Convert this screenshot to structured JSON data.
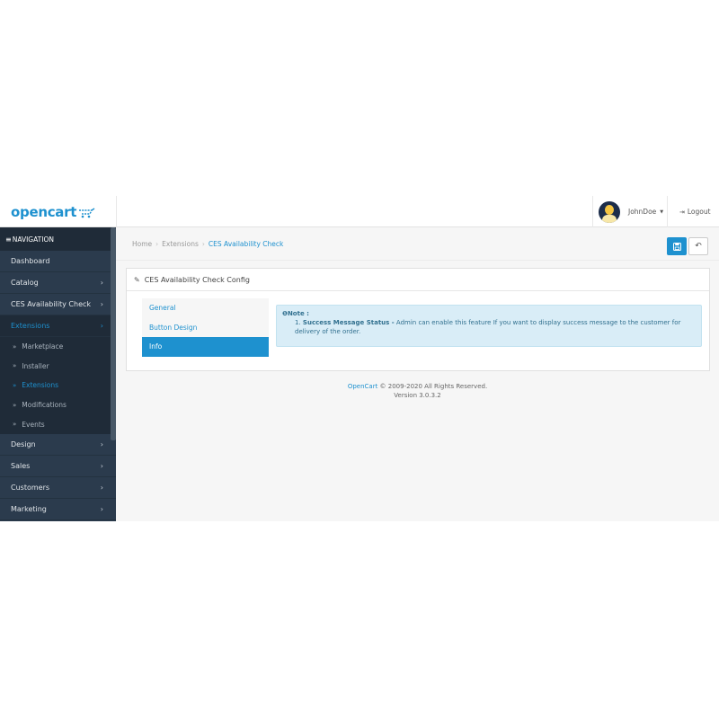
{
  "header": {
    "logo_text": "opencart",
    "username": "JohnDoe",
    "logout_label": "Logout"
  },
  "sidebar": {
    "nav_title": "NAVIGATION",
    "items": [
      {
        "label": "Dashboard",
        "chevron": false
      },
      {
        "label": "Catalog",
        "chevron": true
      },
      {
        "label": "CES Availability Check",
        "chevron": true
      },
      {
        "label": "Extensions",
        "chevron": true,
        "active": true
      }
    ],
    "sub_items": [
      {
        "label": "Marketplace"
      },
      {
        "label": "Installer"
      },
      {
        "label": "Extensions",
        "active": true
      },
      {
        "label": "Modifications"
      },
      {
        "label": "Events"
      }
    ],
    "items_after": [
      {
        "label": "Design"
      },
      {
        "label": "Sales"
      },
      {
        "label": "Customers"
      },
      {
        "label": "Marketing"
      }
    ]
  },
  "breadcrumb": [
    "Home",
    "Extensions",
    "CES Availability Check"
  ],
  "panel": {
    "title": "CES Availability Check Config",
    "tabs": [
      "General",
      "Button Design",
      "Info"
    ],
    "active_tab": "Info",
    "note": {
      "title": "Note :",
      "item_number": "1.",
      "item_bold": "Success Message Status -",
      "item_text": " Admin can enable this feature If you want to display success message to the customer for delivery of the order."
    }
  },
  "footer": {
    "brand": "OpenCart",
    "copyright": " © 2009-2020 All Rights Reserved.",
    "version": "Version 3.0.3.2"
  },
  "colors": {
    "accent": "#1e91cf",
    "sidebar_bg": "#2b3b4d",
    "sidebar_dark": "#1f2b38",
    "note_bg": "#d9edf7"
  }
}
